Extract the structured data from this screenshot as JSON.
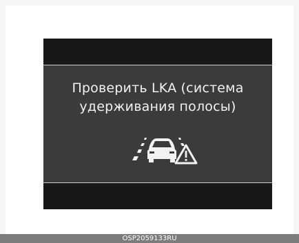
{
  "screen": {
    "message_line1": "Проверить LKA (система",
    "message_line2": "удерживания полосы)",
    "icon": "lane-keeping-warning-icon"
  },
  "caption": {
    "code": "OSP2059133RU"
  },
  "colors": {
    "display_bar": "#171717",
    "display_panel": "#3b3b3b",
    "text": "#f2f2f2",
    "caption_bg": "#7c7c7c"
  }
}
